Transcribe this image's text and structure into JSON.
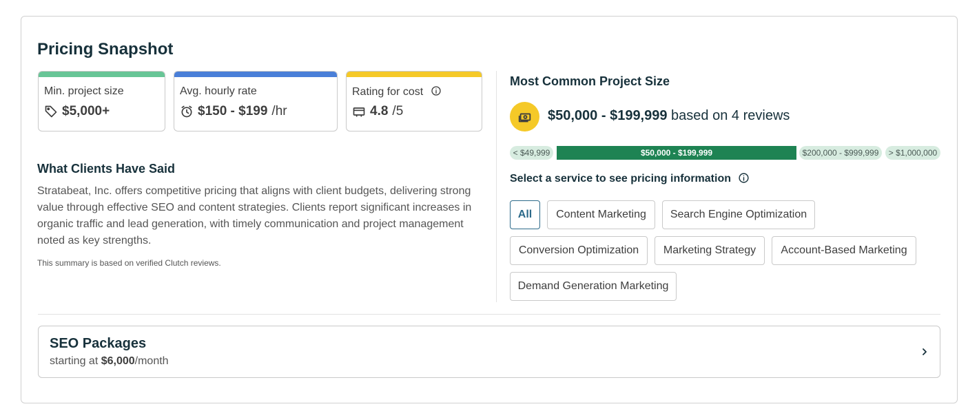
{
  "title": "Pricing Snapshot",
  "colors": {
    "green_bar": "#67c596",
    "blue_bar": "#4a7fd8",
    "yellow_bar": "#f5c928",
    "range_active": "#1e8353",
    "range_muted": "#d7ece0",
    "chip_selected": "#2c6a8a"
  },
  "stats": [
    {
      "label": "Min. project size",
      "icon": "tag-icon",
      "value": "$5,000+",
      "unit": ""
    },
    {
      "label": "Avg. hourly rate",
      "icon": "alarm-clock-icon",
      "value": "$150 - $199",
      "unit": " /hr"
    },
    {
      "label": "Rating for cost",
      "icon": "wallet-icon",
      "value": "4.8",
      "unit": " /5"
    }
  ],
  "clients": {
    "heading": "What Clients Have Said",
    "summary": "Stratabeat, Inc. offers competitive pricing that aligns with client budgets, delivering strong value through effective SEO and content strategies. Clients report significant increases in organic traffic and lead generation, with timely communication and project management noted as key strengths.",
    "footnote": "This summary is based on verified Clutch reviews."
  },
  "common": {
    "heading": "Most Common Project Size",
    "range": "$50,000 - $199,999",
    "suffix": " based on 4 reviews",
    "ranges": [
      {
        "label": "< $49,999",
        "active": false
      },
      {
        "label": "$50,000 - $199,999",
        "active": true
      },
      {
        "label": "$200,000 - $999,999",
        "active": false
      },
      {
        "label": "> $1,000,000",
        "active": false
      }
    ]
  },
  "services": {
    "label": "Select a service to see pricing information",
    "selected": "All",
    "items": [
      "All",
      "Content Marketing",
      "Search Engine Optimization",
      "Conversion Optimization",
      "Marketing Strategy",
      "Account-Based Marketing",
      "Demand Generation Marketing"
    ]
  },
  "package": {
    "title": "SEO Packages",
    "prefix": "starting at ",
    "price": "$6,000",
    "suffix": "/month"
  }
}
